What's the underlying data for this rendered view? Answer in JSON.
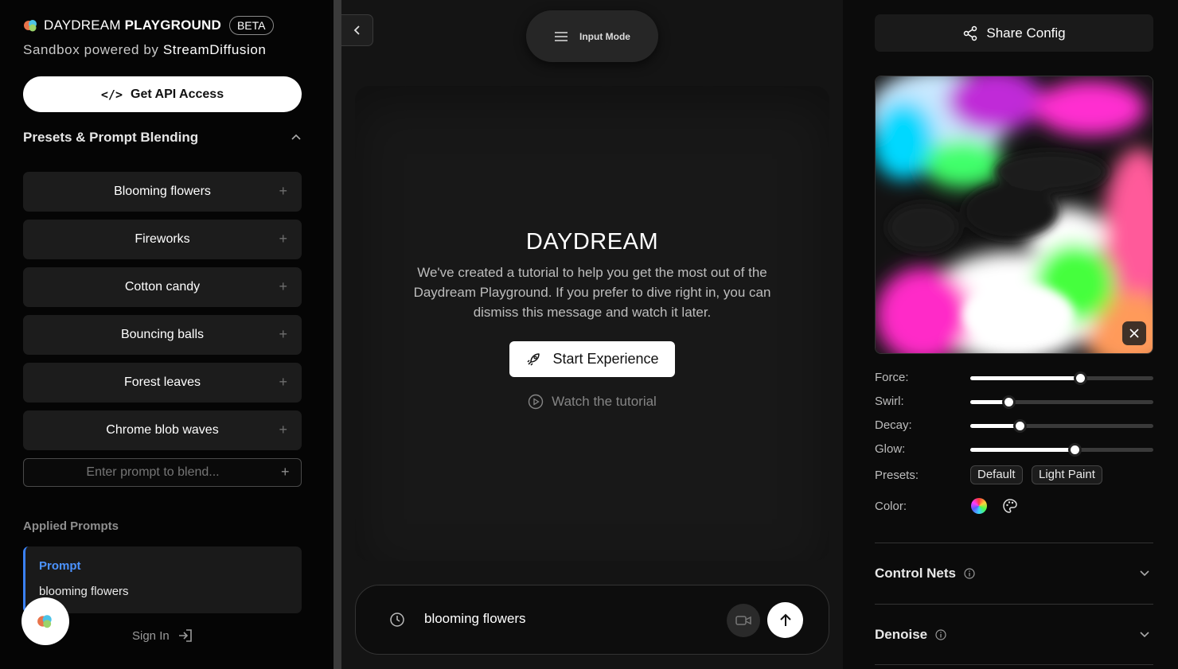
{
  "brand": {
    "name_light": "DAYDREAM",
    "name_bold": "PLAYGROUND",
    "badge": "BETA",
    "subtitle_prefix": "Sandbox powered by",
    "subtitle_brand": "StreamDiffusion"
  },
  "api_button": {
    "label": "Get API Access",
    "code_glyph": "</>"
  },
  "presets_section": {
    "title": "Presets & Prompt Blending"
  },
  "presets": [
    {
      "label": "Blooming flowers"
    },
    {
      "label": "Fireworks"
    },
    {
      "label": "Cotton candy"
    },
    {
      "label": "Bouncing balls"
    },
    {
      "label": "Forest leaves"
    },
    {
      "label": "Chrome blob waves"
    }
  ],
  "blend_input": {
    "placeholder": "Enter prompt to blend..."
  },
  "applied": {
    "title": "Applied Prompts",
    "key": "Prompt",
    "value": "blooming flowers"
  },
  "sign_in": {
    "label": "Sign In"
  },
  "center": {
    "input_mode": "Input Mode",
    "title": "DAYDREAM",
    "body": "We've created a tutorial to help you get the most out of the Daydream Playground. If you prefer to dive right in, you can dismiss this message and watch it later.",
    "start_label": "Start Experience",
    "watch_label": "Watch the tutorial",
    "prompt_text": "blooming flowers"
  },
  "right": {
    "share_label": "Share Config",
    "sliders": [
      {
        "label": "Force:",
        "value": 0.6
      },
      {
        "label": "Swirl:",
        "value": 0.21
      },
      {
        "label": "Decay:",
        "value": 0.27
      },
      {
        "label": "Glow:",
        "value": 0.57
      }
    ],
    "presets_label": "Presets:",
    "preset_chips": [
      "Default",
      "Light Paint"
    ],
    "color_label": "Color:",
    "accordions": [
      {
        "title": "Control Nets"
      },
      {
        "title": "Denoise"
      }
    ]
  },
  "colors": {
    "accent": "#3b82f6",
    "panel": "#181818",
    "sidebar": "#050505"
  },
  "icons": [
    "logo-icon",
    "code-icon",
    "chevron-up-icon",
    "plus-icon",
    "sign-in-icon",
    "chevron-left-icon",
    "menu-icon",
    "rocket-icon",
    "play-circle-icon",
    "clock-icon",
    "video-camera-icon",
    "arrow-up-icon",
    "share-icon",
    "close-icon",
    "palette-icon",
    "info-icon",
    "chevron-down-icon"
  ]
}
